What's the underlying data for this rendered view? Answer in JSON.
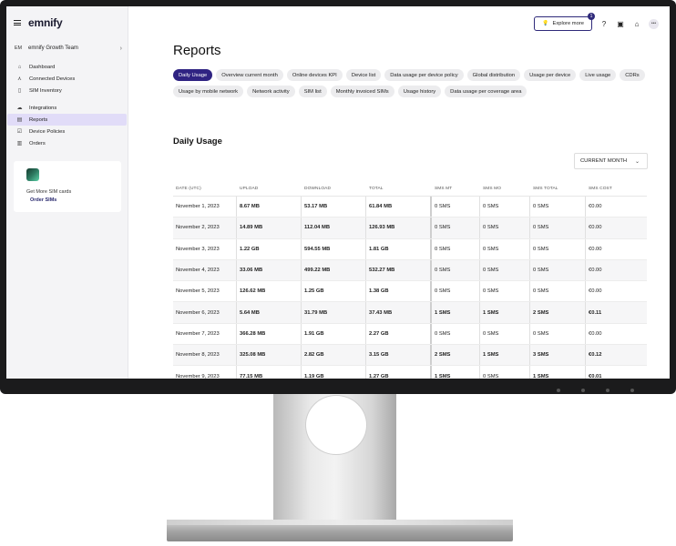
{
  "sidebar": {
    "logo": "emnify",
    "team_initials": "EM",
    "team_name": "emnify Growth Team",
    "items": [
      {
        "label": "Dashboard",
        "icon": "home-icon"
      },
      {
        "label": "Connected Devices",
        "icon": "devices-icon"
      },
      {
        "label": "SIM Inventory",
        "icon": "sim-icon"
      },
      {
        "label": "Integrations",
        "icon": "cloud-icon"
      },
      {
        "label": "Reports",
        "icon": "reports-icon",
        "active": true
      },
      {
        "label": "Device Policies",
        "icon": "policy-icon"
      },
      {
        "label": "Orders",
        "icon": "orders-icon"
      }
    ],
    "promo": {
      "text": "Get More SIM cards",
      "link": "Order SIMs"
    }
  },
  "topbar": {
    "explore_label": "Explore more",
    "explore_badge": "1",
    "avatar_text": "•••"
  },
  "page": {
    "title": "Reports",
    "pills": [
      "Daily Usage",
      "Overview current month",
      "Online devices KPI",
      "Device list",
      "Data usage per device policy",
      "Global distribution",
      "Usage per device",
      "Live usage",
      "CDRs",
      "Usage by mobile network",
      "Network activity",
      "SIM list",
      "Monthly invoiced SIMs",
      "Usage history",
      "Data usage per coverage area"
    ],
    "active_pill": "Daily Usage",
    "section_title": "Daily Usage",
    "period_select": "CURRENT MONTH"
  },
  "table": {
    "columns": [
      "Date (UTC)",
      "Upload",
      "Download",
      "Total",
      "SMS MT",
      "SMS MO",
      "SMS Total",
      "SMS Cost"
    ],
    "rows": [
      [
        "November 1, 2023",
        "8.67 MB",
        "53.17 MB",
        "61.84 MB",
        "0 SMS",
        "0 SMS",
        "0 SMS",
        "€0.00"
      ],
      [
        "November 2, 2023",
        "14.89 MB",
        "112.04 MB",
        "126.93 MB",
        "0 SMS",
        "0 SMS",
        "0 SMS",
        "€0.00"
      ],
      [
        "November 3, 2023",
        "1.22 GB",
        "594.55 MB",
        "1.81 GB",
        "0 SMS",
        "0 SMS",
        "0 SMS",
        "€0.00"
      ],
      [
        "November 4, 2023",
        "33.06 MB",
        "499.22 MB",
        "532.27 MB",
        "0 SMS",
        "0 SMS",
        "0 SMS",
        "€0.00"
      ],
      [
        "November 5, 2023",
        "126.62 MB",
        "1.25 GB",
        "1.38 GB",
        "0 SMS",
        "0 SMS",
        "0 SMS",
        "€0.00"
      ],
      [
        "November 6, 2023",
        "5.64 MB",
        "31.79 MB",
        "37.43 MB",
        "1 SMS",
        "1 SMS",
        "2 SMS",
        "€0.11"
      ],
      [
        "November 7, 2023",
        "366.28 MB",
        "1.91 GB",
        "2.27 GB",
        "0 SMS",
        "0 SMS",
        "0 SMS",
        "€0.00"
      ],
      [
        "November 8, 2023",
        "325.08 MB",
        "2.82 GB",
        "3.15 GB",
        "2 SMS",
        "1 SMS",
        "3 SMS",
        "€0.12"
      ],
      [
        "November 9, 2023",
        "77.15 MB",
        "1.19 GB",
        "1.27 GB",
        "1 SMS",
        "0 SMS",
        "1 SMS",
        "€0.01"
      ]
    ]
  },
  "colors": {
    "accent": "#2f2382",
    "active_nav": "#e1dcf8",
    "sidebar_bg": "#f4f4f6"
  }
}
